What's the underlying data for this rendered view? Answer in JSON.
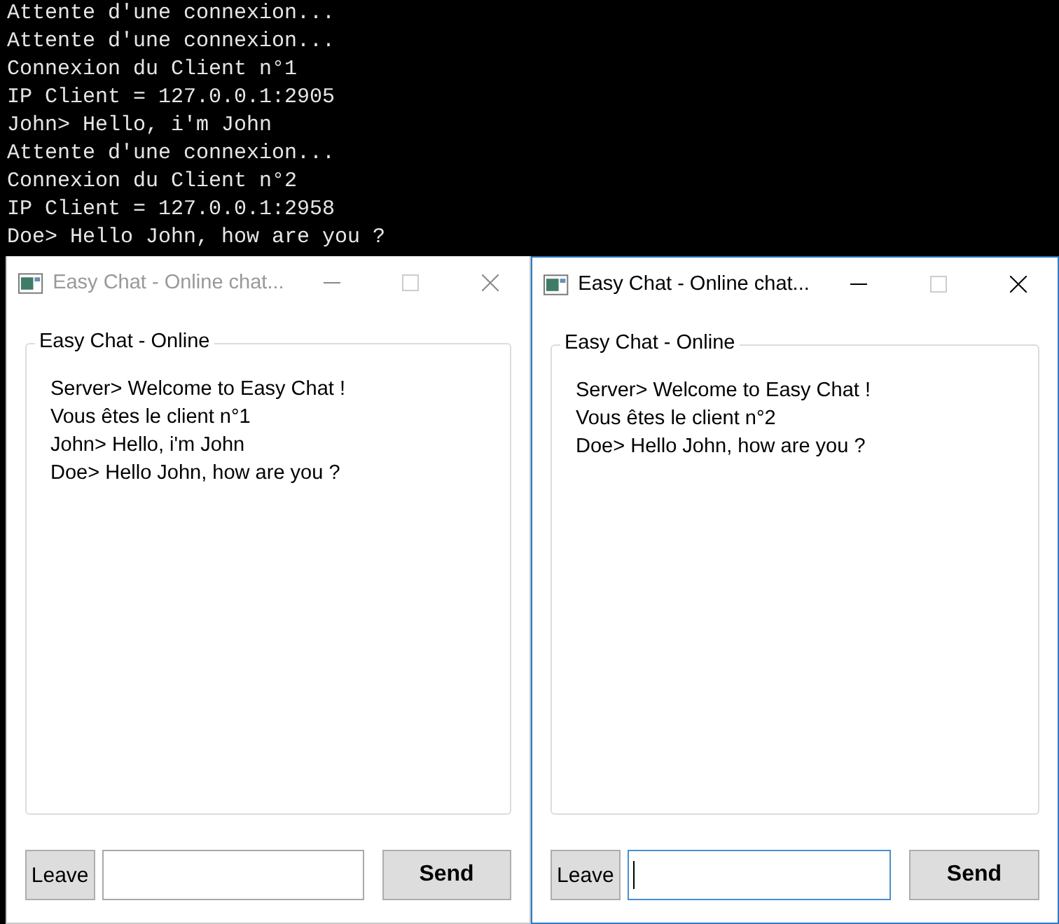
{
  "console": {
    "lines": [
      "Attente d'une connexion...",
      "Attente d'une connexion...",
      "Connexion du Client n°1",
      "IP Client = 127.0.0.1:2905",
      "John> Hello, i'm John",
      "Attente d'une connexion...",
      "Connexion du Client n°2",
      "IP Client = 127.0.0.1:2958",
      "Doe> Hello John, how are you ?"
    ]
  },
  "windows": [
    {
      "title": "Easy Chat - Online chat...",
      "active": false,
      "group_title": "Easy Chat - Online",
      "messages": [
        "Server> Welcome to Easy Chat !",
        "Vous êtes le client n°1",
        "John> Hello, i'm John",
        "Doe> Hello John, how are you ?"
      ],
      "leave_button": "Leave",
      "send_button": "Send",
      "input_focused": false
    },
    {
      "title": "Easy Chat - Online chat...",
      "active": true,
      "group_title": "Easy Chat - Online",
      "messages": [
        "Server> Welcome to Easy Chat !",
        "Vous êtes le client n°2",
        "Doe> Hello John, how are you ?"
      ],
      "leave_button": "Leave",
      "send_button": "Send",
      "input_focused": true
    }
  ]
}
